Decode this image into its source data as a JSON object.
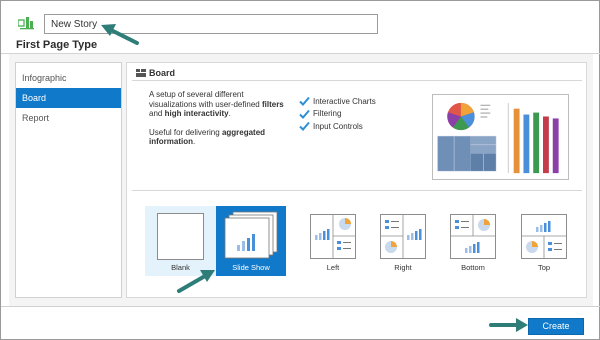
{
  "story": {
    "name_value": "New Story"
  },
  "header": {
    "section_title": "First Page Type"
  },
  "sidebar": {
    "items": [
      {
        "label": "Infographic",
        "active": false
      },
      {
        "label": "Board",
        "active": true
      },
      {
        "label": "Report",
        "active": false
      }
    ]
  },
  "board": {
    "title": "Board",
    "description_1_plain": "A setup of several different visualizations with user-defined",
    "description_1_bold_a": "filters",
    "description_1_and": "and",
    "description_1_bold_b": "high interactivity",
    "description_2_plain": "Useful for delivering",
    "description_2_bold": "aggregated information",
    "features": [
      "Interactive Charts",
      "Filtering",
      "Input Controls"
    ]
  },
  "layouts": [
    {
      "label": "Blank",
      "state": "hover"
    },
    {
      "label": "Slide Show",
      "state": "selected"
    },
    {
      "label": "Left",
      "state": "normal"
    },
    {
      "label": "Right",
      "state": "normal"
    },
    {
      "label": "Bottom",
      "state": "normal"
    },
    {
      "label": "Top",
      "state": "normal"
    }
  ],
  "footer": {
    "create_label": "Create"
  },
  "colors": {
    "accent": "#1179c9",
    "selection_light": "#e4f2fb",
    "check": "#2d8fd6",
    "annotation_arrow": "#2e7d78"
  }
}
